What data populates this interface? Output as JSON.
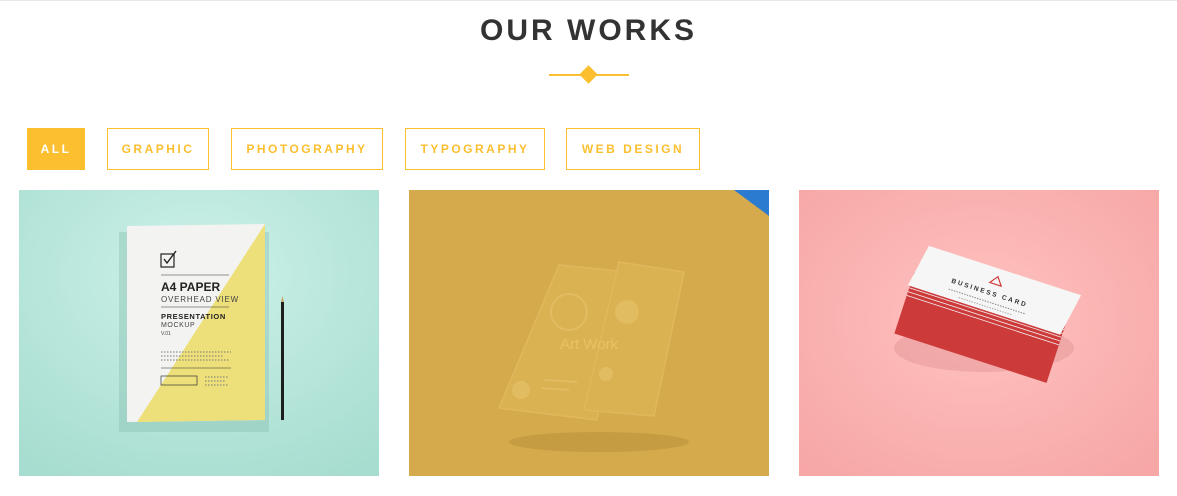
{
  "header": {
    "title": "OUR WORKS"
  },
  "filters": [
    {
      "label": "ALL",
      "active": true
    },
    {
      "label": "GRAPHIC",
      "active": false
    },
    {
      "label": "PHOTOGRAPHY",
      "active": false
    },
    {
      "label": "TYPOGRAPHY",
      "active": false
    },
    {
      "label": "WEB DESIGN",
      "active": false
    }
  ],
  "works": [
    {
      "title": "A4 PAPER",
      "subtitle": "OVERHEAD VIEW",
      "heading": "PRESENTATION",
      "heading2": "MOCKUP",
      "version": "V.01",
      "bg": "#b9e8dc"
    },
    {
      "overlay": "Art Work",
      "bg": "#d7ab4c"
    },
    {
      "card_title": "BUSINESS CARD",
      "bg": "#f9b4b2"
    }
  ],
  "colors": {
    "accent": "#fbbf2f",
    "title": "#333333",
    "corner_ribbon": "#2b7bd0"
  }
}
